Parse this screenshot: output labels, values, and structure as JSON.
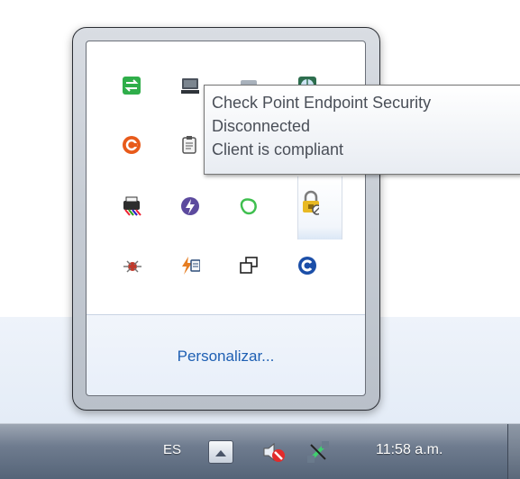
{
  "overflow_area": {
    "icons": [
      {
        "name": "sync-icon",
        "glyph": "⇆",
        "color": "#2ea043"
      },
      {
        "name": "computer-icon",
        "glyph": "▆",
        "color": "#555c66"
      },
      {
        "name": "generic-app-icon",
        "glyph": "▭",
        "color": "#9aa5b1"
      },
      {
        "name": "network-globe-icon",
        "glyph": "◉",
        "color": "#2d7a4f"
      },
      {
        "name": "orange-swirl-icon",
        "glyph": "G",
        "color": "#e5581e"
      },
      {
        "name": "clipboard-icon",
        "glyph": "📋",
        "color": "#5c6470"
      },
      {
        "name": "printer-colors-icon",
        "glyph": "▤",
        "color": "#333333"
      },
      {
        "name": "purple-bolt-icon",
        "glyph": "⚡",
        "color": "#6b4ea8"
      },
      {
        "name": "green-blob-icon",
        "glyph": "◯",
        "color": "#35b04b"
      },
      {
        "name": "lock-icon",
        "glyph": "🔒",
        "color": "#d2a11c"
      },
      {
        "name": "red-bug-icon",
        "glyph": "✱",
        "color": "#c0392b"
      },
      {
        "name": "lightning-note-icon",
        "glyph": "⚡",
        "color": "#d35400"
      },
      {
        "name": "window-copies-icon",
        "glyph": "⧉",
        "color": "#222222"
      },
      {
        "name": "blue-c-icon",
        "glyph": "C",
        "color": "#1a56b8"
      }
    ],
    "customize_link": "Personalizar..."
  },
  "tooltip": {
    "line1": "Check Point Endpoint Security",
    "line2": "Disconnected",
    "line3": "Client is compliant"
  },
  "taskbar": {
    "language": "ES",
    "clock": "11:58 a.m.",
    "show_hidden_icon": "chevron-up",
    "volume_icon": "volume-muted",
    "network_icon": "network-disconnected"
  }
}
